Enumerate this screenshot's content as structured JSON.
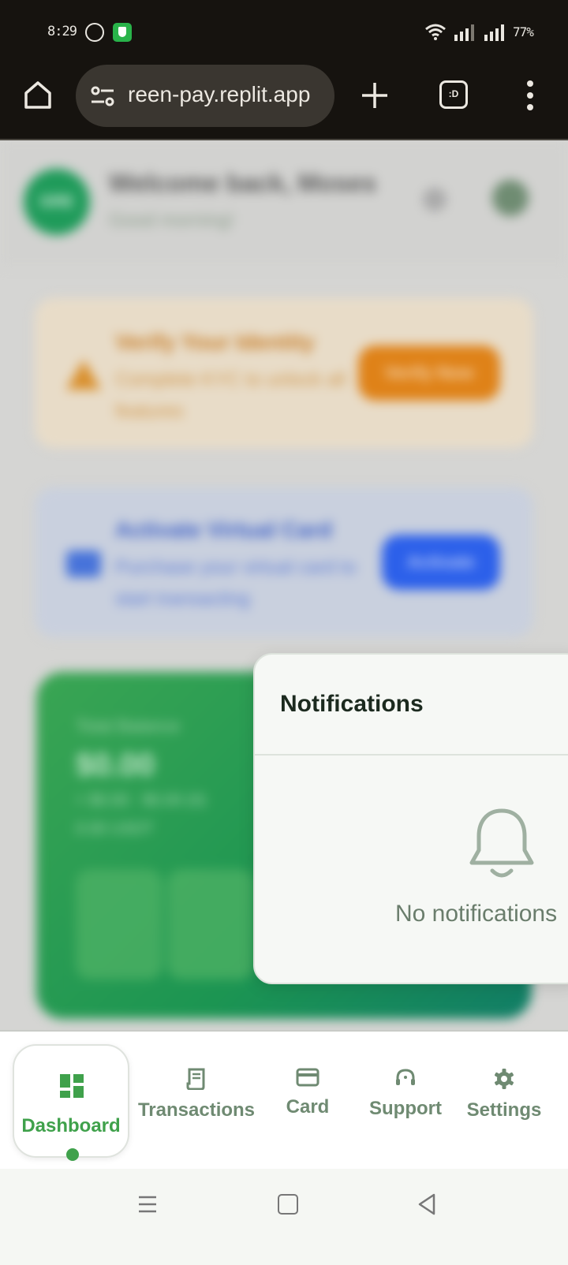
{
  "status_bar": {
    "time": "8:29",
    "battery": "77%",
    "icons": [
      "whatsapp-icon",
      "shield-app-icon",
      "wifi-icon",
      "signal-icon",
      "signal-icon"
    ]
  },
  "browser": {
    "url": "reen-pay.replit.app",
    "tab_count": ":D",
    "icons": [
      "home-icon",
      "site-settings-icon",
      "new-tab-icon",
      "tabs-icon",
      "menu-icon"
    ]
  },
  "page": {
    "welcome": "Welcome back, Moses",
    "greeting": "Good morning!",
    "avatar_initials": "GRE",
    "kyc": {
      "title": "Verify Your Identity",
      "text": "Complete KYC to unlock all features",
      "button": "Verify Now"
    },
    "virtual_card": {
      "title": "Activate Virtual Card",
      "text": "Purchase your virtual card to start transacting",
      "button": "Activate"
    },
    "balance": {
      "label": "Total Balance",
      "value": "$0.00",
      "sub1": "+ $0.00 · $0.00 (0)",
      "sub2": "0.00 USDT"
    }
  },
  "notifications": {
    "title": "Notifications",
    "empty_text": "No notifications"
  },
  "bottom_nav": {
    "items": [
      {
        "label": "Dashboard",
        "icon": "dashboard-icon",
        "active": true
      },
      {
        "label": "Transactions",
        "icon": "receipt-icon",
        "active": false
      },
      {
        "label": "Card",
        "icon": "card-icon",
        "active": false
      },
      {
        "label": "Support",
        "icon": "headset-icon",
        "active": false
      },
      {
        "label": "Settings",
        "icon": "gear-icon",
        "active": false
      }
    ]
  },
  "colors": {
    "brand_green": "#3fa14b",
    "inactive_nav": "#6f8a72",
    "kyc_orange": "#df8218",
    "activate_blue": "#2c60ea"
  }
}
